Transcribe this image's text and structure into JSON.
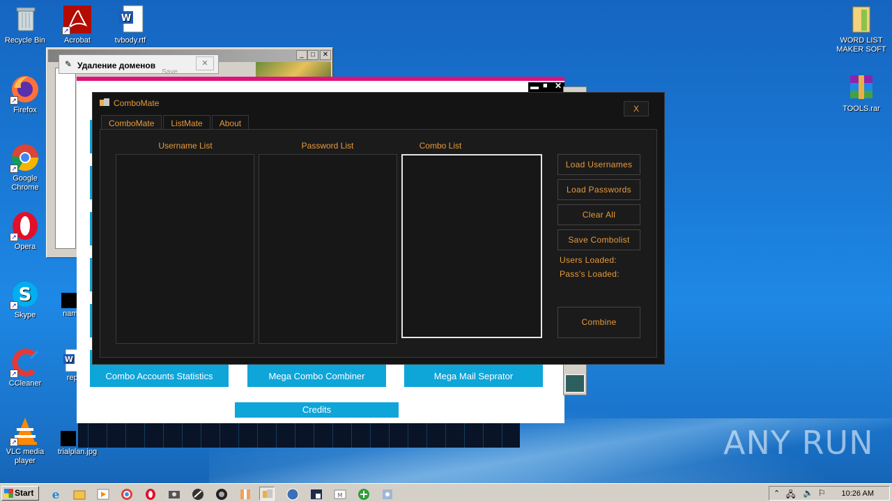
{
  "desktop": {
    "icons_left": [
      {
        "label": "Recycle Bin",
        "icon": "recycle-bin-icon"
      },
      {
        "label": "Firefox",
        "icon": "firefox-icon"
      },
      {
        "label": "Google Chrome",
        "icon": "chrome-icon"
      },
      {
        "label": "Opera",
        "icon": "opera-icon"
      },
      {
        "label": "Skype",
        "icon": "skype-icon"
      },
      {
        "label": "CCleaner",
        "icon": "ccleaner-icon"
      },
      {
        "label": "VLC media player",
        "icon": "vlc-icon"
      }
    ],
    "icons_col2": [
      {
        "label": "Acrobat",
        "icon": "acrobat-icon"
      },
      {
        "label": "namep",
        "icon": "black-file-icon"
      },
      {
        "label": "replyl",
        "icon": "word-doc-icon"
      },
      {
        "label": "trialplan.jpg",
        "icon": "image-file-icon"
      }
    ],
    "icons_col3": [
      {
        "label": "tvbody.rtf",
        "icon": "word-doc-icon"
      }
    ],
    "icons_right": [
      {
        "label": "WORD LIST MAKER SOFT",
        "icon": "folder-icon"
      },
      {
        "label": "TOOLS.rar",
        "icon": "winrar-icon"
      }
    ],
    "watermark": "ANY RUN"
  },
  "bg_windows": {
    "domain_dialog_title": "Удаление доменов",
    "domain_dialog_save": "Save",
    "menu_buttons": [
      "Combo Accounts Statistics",
      "Mega Combo Combiner",
      "Mega Mail Seprator"
    ],
    "credits": "Credits"
  },
  "combomate": {
    "title": "ComboMate",
    "close": "X",
    "tabs": [
      "ComboMate",
      "ListMate",
      "About"
    ],
    "lists": {
      "username_label": "Username List",
      "password_label": "Password List",
      "combo_label": "Combo List"
    },
    "buttons": {
      "load_usernames": "Load Usernames",
      "load_passwords": "Load Passwords",
      "clear_all": "Clear All",
      "save_combolist": "Save Combolist",
      "combine": "Combine"
    },
    "users_loaded": "Users Loaded:",
    "pass_loaded": "Pass's Loaded:"
  },
  "taskbar": {
    "start": "Start",
    "clock": "10:26 AM"
  },
  "colors": {
    "accent_orange": "#e89a3c",
    "app_bg": "#141414",
    "cyan_button": "#0ea5d9",
    "pink_bar": "#e0127e"
  }
}
